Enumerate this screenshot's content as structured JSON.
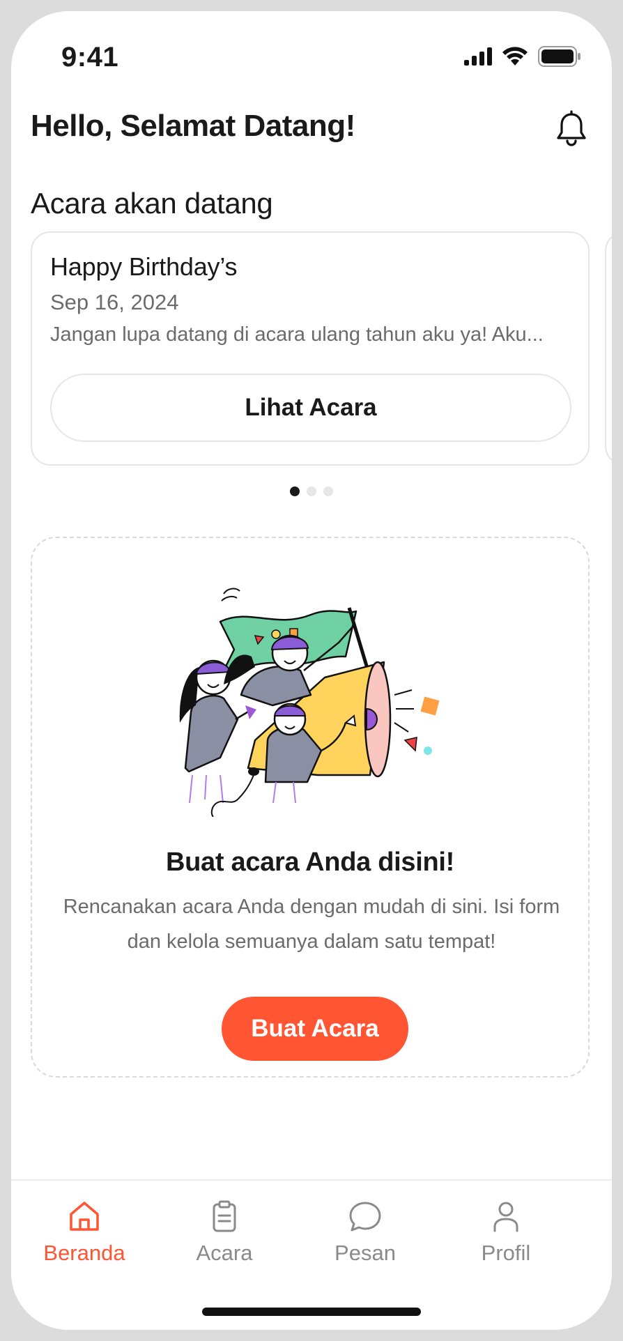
{
  "status_bar": {
    "time": "9:41"
  },
  "header": {
    "greeting": "Hello, Selamat Datang!"
  },
  "upcoming": {
    "title": "Acara akan datang",
    "event": {
      "name": "Happy Birthday’s",
      "date": "Sep 16, 2024",
      "description": "Jangan lupa datang di acara ulang tahun aku ya! Aku...",
      "button_label": "Lihat Acara"
    },
    "carousel": {
      "count": 3,
      "active_index": 0
    }
  },
  "create": {
    "title": "Buat acara Anda disini!",
    "description_line1": "Rencanakan acara Anda dengan mudah di sini. Isi form",
    "description_line2": "dan kelola semuanya dalam satu tempat!",
    "button_label": "Buat Acara"
  },
  "nav": {
    "items": [
      {
        "label": "Beranda",
        "icon": "home-icon",
        "active": true
      },
      {
        "label": "Acara",
        "icon": "clipboard-icon",
        "active": false
      },
      {
        "label": "Pesan",
        "icon": "chat-bubble-icon",
        "active": false
      },
      {
        "label": "Profil",
        "icon": "person-icon",
        "active": false
      }
    ]
  },
  "colors": {
    "accent": "#ff5533",
    "text": "#1a1a1a",
    "muted": "#6b6b6b",
    "border": "#e6e6e6"
  }
}
